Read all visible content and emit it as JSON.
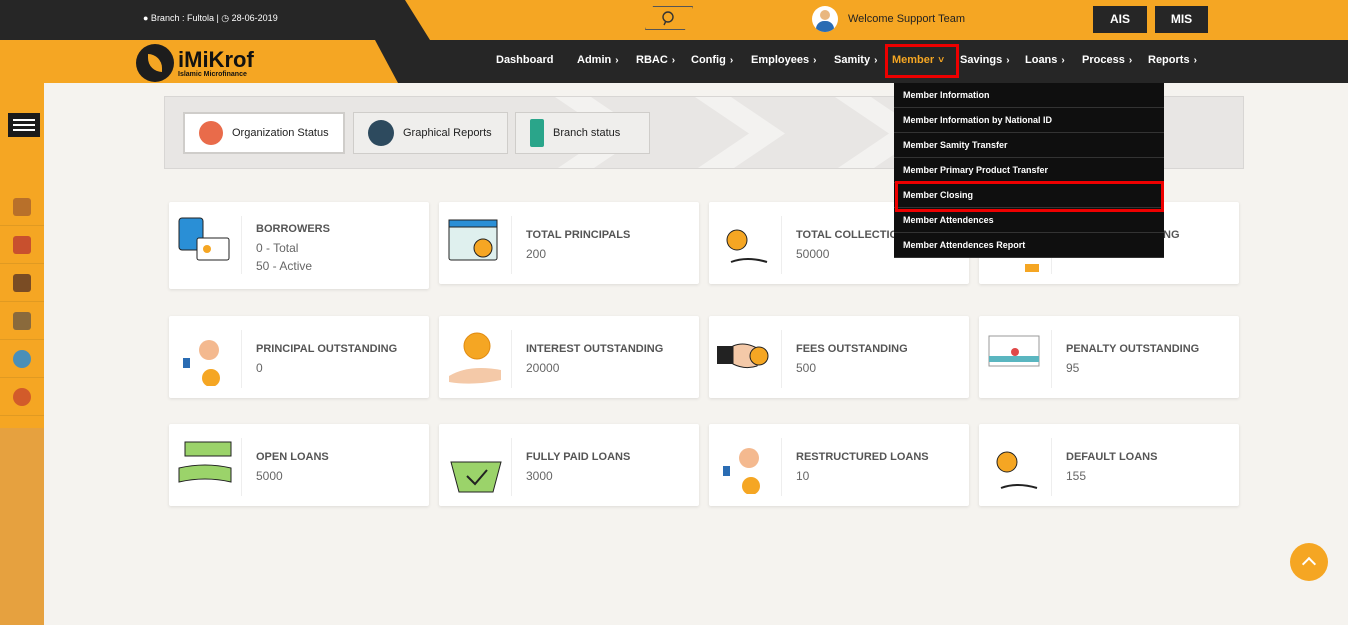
{
  "topbar": {
    "branch_text": "● Branch : Fultola | ◷ 28-06-2019",
    "welcome": "Welcome Support Team",
    "buttons": [
      "AIS",
      "MIS"
    ]
  },
  "logo": {
    "name": "iMiKrof",
    "subtitle": "Islamic Microfinance"
  },
  "nav": [
    {
      "label": "Dashboard",
      "chev": ""
    },
    {
      "label": "Admin",
      "chev": "›"
    },
    {
      "label": "RBAC",
      "chev": "›"
    },
    {
      "label": "Config",
      "chev": "›"
    },
    {
      "label": "Employees",
      "chev": "›"
    },
    {
      "label": "Samity",
      "chev": "›"
    },
    {
      "label": "Member",
      "chev": "˅"
    },
    {
      "label": "Savings",
      "chev": "›"
    },
    {
      "label": "Loans",
      "chev": "›"
    },
    {
      "label": "Process",
      "chev": "›"
    },
    {
      "label": "Reports",
      "chev": "›"
    }
  ],
  "member_dropdown": [
    "Member Information",
    "Member Information by National ID",
    "Member Samity Transfer",
    "Member Primary Product Transfer",
    "Member Closing",
    "Member Attendences",
    "Member Attendences Report"
  ],
  "tabs": [
    "Organization Status",
    "Graphical Reports",
    "Branch status"
  ],
  "cards": [
    {
      "label": "BORROWERS",
      "values": [
        "0 - Total",
        "50 - Active"
      ],
      "icon": "borrowers-icon"
    },
    {
      "label": "TOTAL PRINCIPALS",
      "values": [
        "200"
      ],
      "icon": "principals-icon"
    },
    {
      "label": "TOTAL COLLECTIO",
      "values": [
        "50000"
      ],
      "icon": "collection-icon"
    },
    {
      "label": "NG",
      "values": [
        ""
      ],
      "icon": "hidden-card-icon"
    },
    {
      "label": "PRINCIPAL OUTSTANDING",
      "values": [
        "0"
      ],
      "icon": "principal-outstanding-icon"
    },
    {
      "label": "INTEREST OUTSTANDING",
      "values": [
        "20000"
      ],
      "icon": "interest-outstanding-icon"
    },
    {
      "label": "FEES OUTSTANDING",
      "values": [
        "500"
      ],
      "icon": "fees-outstanding-icon"
    },
    {
      "label": "PENALTY OUTSTANDING",
      "values": [
        "95"
      ],
      "icon": "penalty-outstanding-icon"
    },
    {
      "label": "OPEN LOANS",
      "values": [
        "5000"
      ],
      "icon": "open-loans-icon"
    },
    {
      "label": "FULLY PAID LOANS",
      "values": [
        "3000"
      ],
      "icon": "fully-paid-loans-icon"
    },
    {
      "label": "RESTRUCTURED LOANS",
      "values": [
        "10"
      ],
      "icon": "restructured-loans-icon"
    },
    {
      "label": "DEFAULT LOANS",
      "values": [
        "155"
      ],
      "icon": "default-loans-icon"
    }
  ],
  "colors": {
    "accent": "#f5a623",
    "dark": "#262626",
    "highlight": "#ee0000"
  }
}
